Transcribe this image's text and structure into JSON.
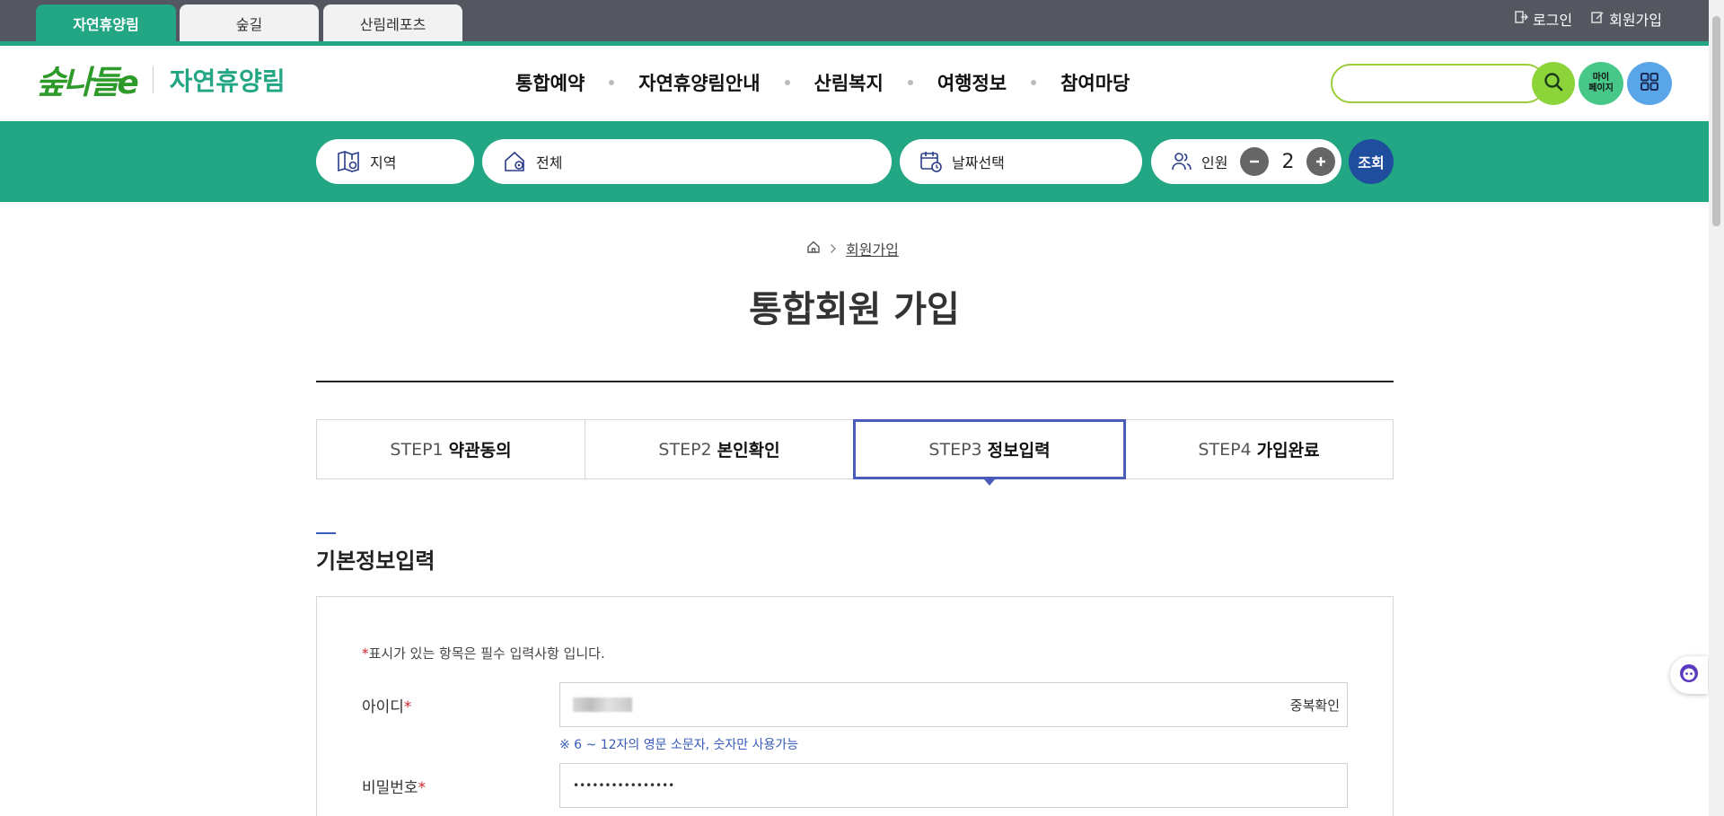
{
  "top_tabs": [
    {
      "label": "자연휴양림",
      "active": true
    },
    {
      "label": "숲길",
      "active": false
    },
    {
      "label": "산림레포츠",
      "active": false
    }
  ],
  "utility_links": {
    "login": "로그인",
    "signup": "회원가입"
  },
  "logo": {
    "mark": "숲나들e",
    "text": "자연휴양림"
  },
  "gnb": [
    "통합예약",
    "자연휴양림안내",
    "산림복지",
    "여행정보",
    "참여마당"
  ],
  "search": {
    "placeholder": "",
    "mypage_label": "마이\n페이지"
  },
  "quick_search": {
    "region_label": "지역",
    "area_value": "전체",
    "date_placeholder": "날짜선택",
    "people_label": "인원",
    "people_count": "2",
    "query_label": "조회"
  },
  "breadcrumb": {
    "current": "회원가입"
  },
  "page_title": "통합회원 가입",
  "steps": [
    {
      "num": "STEP1",
      "name": "약관동의",
      "active": false
    },
    {
      "num": "STEP2",
      "name": "본인확인",
      "active": false
    },
    {
      "num": "STEP3",
      "name": "정보입력",
      "active": true
    },
    {
      "num": "STEP4",
      "name": "가입완료",
      "active": false
    }
  ],
  "section": {
    "title": "기본정보입력"
  },
  "form": {
    "required_note_star": "*",
    "required_note": "표시가 있는 항목은 필수 입력사항 입니다.",
    "id_label": "아이디",
    "dup_check_label": "중복확인",
    "id_hint": "※ 6 ~ 12자의 영문 소문자, 숫자만 사용가능",
    "password_label": "비밀번호",
    "password_value": "••••••••••••••••",
    "required_star": "*"
  },
  "colors": {
    "brand_green": "#22a683",
    "topbar_gray": "#545660",
    "step_active_border": "#4a5cba",
    "query_button": "#1f4e9e",
    "search_green": "#8cd43a"
  }
}
